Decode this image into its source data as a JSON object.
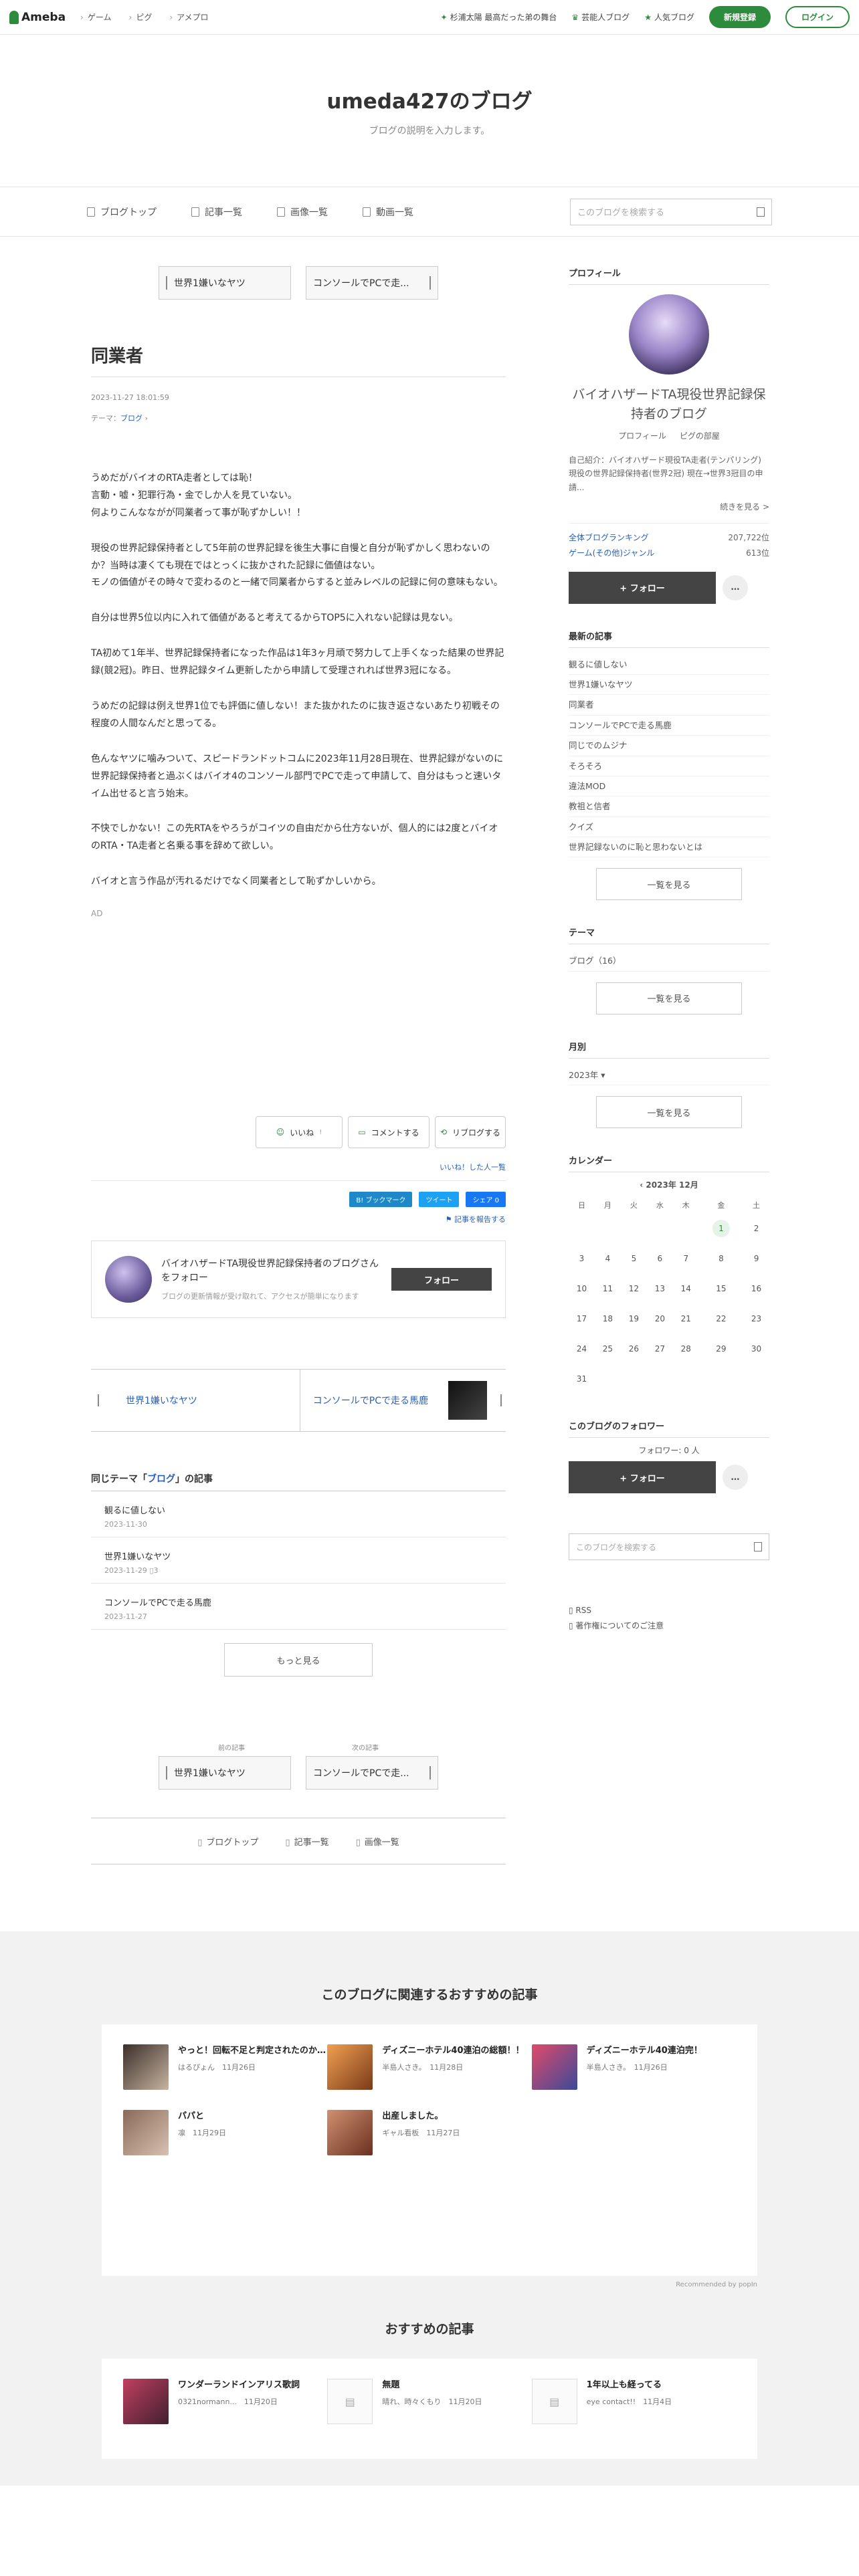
{
  "global_header": {
    "logo": "Ameba",
    "nav": [
      "ゲーム",
      "ピグ",
      "アメプロ"
    ],
    "right": [
      "杉浦太陽 最高だった弟の舞台",
      "芸能人ブログ",
      "人気ブログ"
    ],
    "register": "新規登録",
    "login": "ログイン"
  },
  "blog_header": {
    "title": "umeda427のブログ",
    "description": "ブログの説明を入力します。"
  },
  "blog_nav": {
    "items": [
      "ブログトップ",
      "記事一覧",
      "画像一覧",
      "動画一覧"
    ],
    "search_placeholder": "このブログを検索する"
  },
  "pager_top": {
    "prev": "世界1嫌いなヤツ",
    "next": "コンソールでPCで走..."
  },
  "entry": {
    "title": "同業者",
    "datetime": "2023-11-27 18:01:59",
    "theme_label": "テーマ：",
    "theme": "ブログ",
    "paragraphs": [
      [
        "うめだがバイオのRTA走者としては恥！",
        "言動・嘘・犯罪行為・金でしか人を見ていない。",
        "何よりこんなながが同業者って事が恥ずかしい！！"
      ],
      [
        "現役の世界記録保持者として5年前の世界記録を後生大事に自慢と自分が恥ずかしく思わないのか？当時は凄くても現在ではとっくに抜かされた記録に価値はない。",
        "モノの価値がその時々で変わるのと一緒で同業者からすると並みレベルの記録に何の意味もない。"
      ],
      [
        "自分は世界5位以内に入れて価値があると考えてるからTOP5に入れない記録は見ない。"
      ],
      [
        "TA初めて1年半、世界記録保持者になった作品は1年3ヶ月頑で努力して上手くなった結果の世界記録(競2冠)。昨日、世界記録タイム更新したから申請して受理されれば世界3冠になる。"
      ],
      [
        "うめだの記録は例え世界1位でも評価に値しない！また抜かれたのに抜き返さないあたり初戦その程度の人間なんだと思ってる。"
      ],
      [
        "色んなヤツに噛みついて、スピードランドットコムに2023年11月28日現在、世界記録がないのに世界記録保持者と過ぶくはバイオ4のコンソール部門でPCで走って申請して、自分はもっと速いタイム出せると言う始末。"
      ],
      [
        "不快でしかない！この先RTAをやろうがコイツの自由だから仕方ないが、個人的には2度とバイオのRTA・TA走者と名乗る事を辞めて欲しい。"
      ],
      [
        "バイオと言う作品が汚れるだけでなく同業者として恥ずかしいから。"
      ]
    ],
    "ad": "AD"
  },
  "actions": {
    "like": "いいね",
    "like_count": "!",
    "comment": "コメントする",
    "reblog": "リブログする",
    "liked_link": "いいね！した人一覧",
    "hatena": "B! ブックマーク",
    "tweet": "ツイート",
    "fb": "シェア 0",
    "report": "記事を報告する"
  },
  "follow_box": {
    "text": "バイオハザードTA現役世界記録保持者のブログさんをフォロー",
    "sub": "ブログの更新情報が受け取れて、アクセスが簡単になります",
    "button": "フォロー"
  },
  "adjacent": {
    "prev": "世界1嫌いなヤツ",
    "next": "コンソールでPCで走る馬鹿"
  },
  "same_theme": {
    "prefix": "同じテーマ「",
    "theme": "ブログ",
    "suffix": "」の記事",
    "items": [
      {
        "title": "観るに値しない",
        "date": "2023-11-30"
      },
      {
        "title": "世界1嫌いなヤツ",
        "date": "2023-11-29",
        "comments": "3"
      },
      {
        "title": "コンソールでPCで走る馬鹿",
        "date": "2023-11-27"
      }
    ],
    "more": "もっと見る"
  },
  "pager_bottom": {
    "prev_label": "前の記事",
    "next_label": "次の記事",
    "prev": "世界1嫌いなヤツ",
    "next": "コンソールでPCで走..."
  },
  "bottom_nav": [
    "ブログトップ",
    "記事一覧",
    "画像一覧"
  ],
  "sidebar": {
    "profile_h": "プロフィール",
    "name": "バイオハザードTA現役世界記録保持者のブログ",
    "links": [
      "プロフィール",
      "ピグの部屋"
    ],
    "desc": "自己紹介：バイオハザード現役TA走者(テンパリング) 現役の世界記録保持者(世界2冠) 現在→世界3冠目の申請...",
    "desc_more": "続きを見る >",
    "rank": [
      {
        "k": "全体ブログランキング",
        "v": "207,722位"
      },
      {
        "k": "ゲーム(その他)ジャンル",
        "v": "613位"
      }
    ],
    "follow": "+ フォロー",
    "dots": "…",
    "recent_h": "最新の記事",
    "recent": [
      "観るに値しない",
      "世界1嫌いなヤツ",
      "同業者",
      "コンソールでPCで走る馬鹿",
      "同じでのムジナ",
      "そろそろ",
      "違法MOD",
      "教祖と信者",
      "クイズ",
      "世界記録ないのに恥と思わないとは"
    ],
    "more": "一覧を見る",
    "theme_h": "テーマ",
    "themes": [
      "ブログ（16）"
    ],
    "monthly_h": "月別",
    "months": [
      "2023年"
    ],
    "cal_h": "カレンダー",
    "cal_month": "2023年 12月",
    "weekdays": [
      "日",
      "月",
      "火",
      "水",
      "木",
      "金",
      "土"
    ],
    "weeks": [
      [
        "",
        "",
        "",
        "",
        "",
        "1",
        "2"
      ],
      [
        "3",
        "4",
        "5",
        "6",
        "7",
        "8",
        "9"
      ],
      [
        "10",
        "11",
        "12",
        "13",
        "14",
        "15",
        "16"
      ],
      [
        "17",
        "18",
        "19",
        "20",
        "21",
        "22",
        "23"
      ],
      [
        "24",
        "25",
        "26",
        "27",
        "28",
        "29",
        "30"
      ],
      [
        "31",
        "",
        "",
        "",
        "",
        "",
        ""
      ]
    ],
    "cal_today": "1",
    "followers_h": "このブログのフォロワー",
    "followers": "フォロワー: 0 人",
    "search_placeholder": "このブログを検索する",
    "rss": "RSS",
    "copyright": "著作権についてのご注意"
  },
  "recommend": {
    "h": "このブログに関連するおすすめの記事",
    "items": [
      {
        "title": "やっと！回転不足と判定されたのか…",
        "author": "はるぴょん",
        "date": "11月26日"
      },
      {
        "title": "ディズニーホテル40連泊の総額！！",
        "author": "半島人さき。",
        "date": "11月28日"
      },
      {
        "title": "ディズニーホテル40連泊完！",
        "author": "半島人さき。",
        "date": "11月26日"
      },
      {
        "title": "パパと",
        "author": "凛",
        "date": "11月29日"
      },
      {
        "title": "出産しました。",
        "author": "ギャル看板",
        "date": "11月27日"
      }
    ],
    "note": "Recommended by popIn"
  },
  "recommend2": {
    "h": "おすすめの記事",
    "items": [
      {
        "title": "ワンダーランドインアリス歌詞",
        "author": "0321normann...",
        "date": "11月20日"
      },
      {
        "title": "無題",
        "author": "晴れ、時々くもり",
        "date": "11月20日"
      },
      {
        "title": "1年以上も経ってる",
        "author": "eye contact!!",
        "date": "11月4日"
      }
    ]
  }
}
